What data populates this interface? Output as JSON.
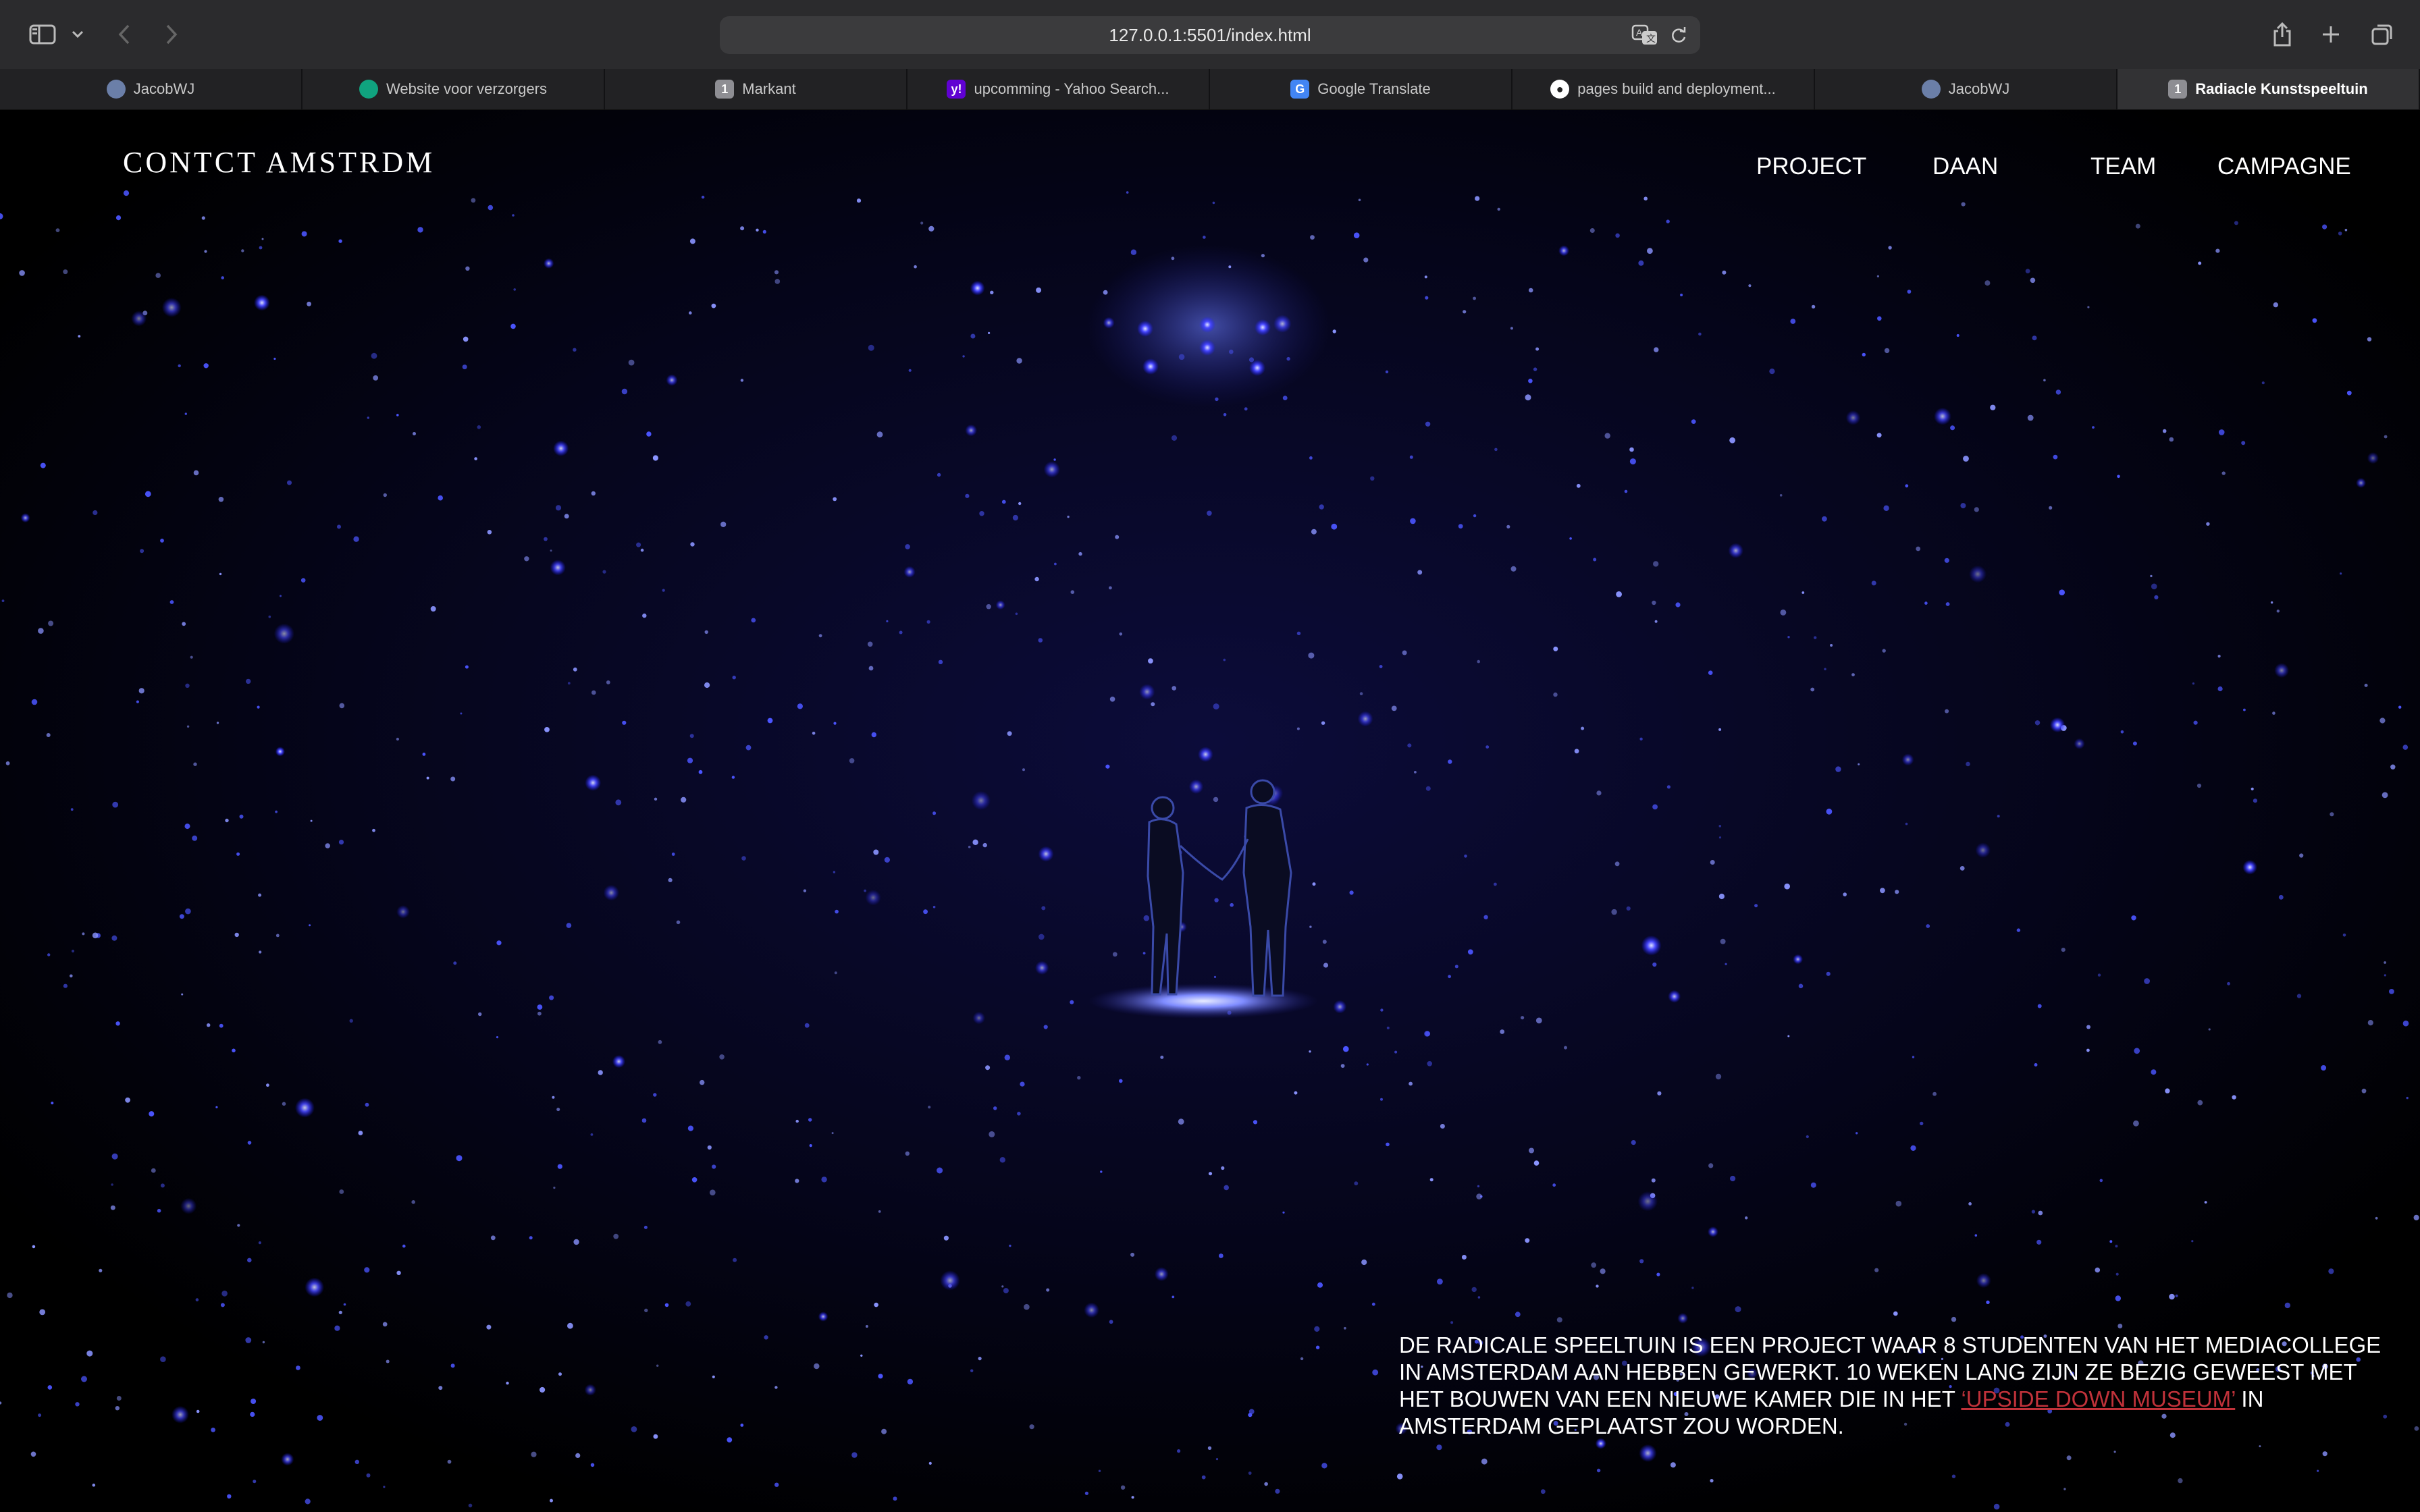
{
  "browser": {
    "url": "127.0.0.1:5501/index.html",
    "tabs": [
      {
        "label": "JacobWJ",
        "favicon": "avatar-icon",
        "color": "#6b7fa8"
      },
      {
        "label": "Website voor verzorgers",
        "favicon": "chatgpt-icon",
        "color": "#10a37f"
      },
      {
        "label": "Markant",
        "favicon": "number-one-icon",
        "glyph": "1",
        "color": "#8e8e93"
      },
      {
        "label": "upcomming - Yahoo Search...",
        "favicon": "yahoo-icon",
        "glyph": "y!",
        "color": "#6001d2"
      },
      {
        "label": "Google Translate",
        "favicon": "google-translate-icon",
        "glyph": "G",
        "color": "#4285f4"
      },
      {
        "label": "pages build and deployment...",
        "favicon": "github-icon",
        "color": "#ffffff"
      },
      {
        "label": "JacobWJ",
        "favicon": "avatar-icon",
        "color": "#6b7fa8"
      },
      {
        "label": "Radiacle Kunstspeeltuin",
        "favicon": "number-one-icon",
        "glyph": "1",
        "color": "#8e8e93",
        "active": true
      }
    ]
  },
  "site": {
    "logo": "CONTCT AMSTRDM",
    "nav": [
      "PROJECT",
      "DAAN",
      "TEAM",
      "CAMPAGNE"
    ],
    "intro": {
      "before": "De Radicale Speeltuin is een project waar 8 studenten van het Mediacollege in Amsterdam aan hebben gewerkt. 10 weken lang zijn ze bezig geweest met het bouwen van een nieuwe kamer die in het ",
      "link": "‘Upside Down Museum’",
      "after": " in Amsterdam geplaatst zou worden."
    },
    "colors": {
      "background": "#000000",
      "accent": "#c0323a",
      "stars": "#3a3aff"
    }
  }
}
